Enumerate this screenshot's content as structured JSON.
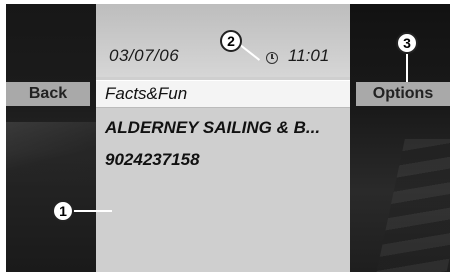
{
  "status_bar": {
    "date": "03/07/06",
    "time": "11:01",
    "clock_icon": "clock-icon"
  },
  "softkeys": {
    "left": "Back",
    "right": "Options"
  },
  "list": [
    {
      "label": "Facts&Fun",
      "selected": true
    },
    {
      "label": "ALDERNEY SAILING & B...",
      "selected": false
    },
    {
      "label": "9024237158",
      "selected": false
    }
  ],
  "callouts": [
    "1",
    "2",
    "3"
  ]
}
